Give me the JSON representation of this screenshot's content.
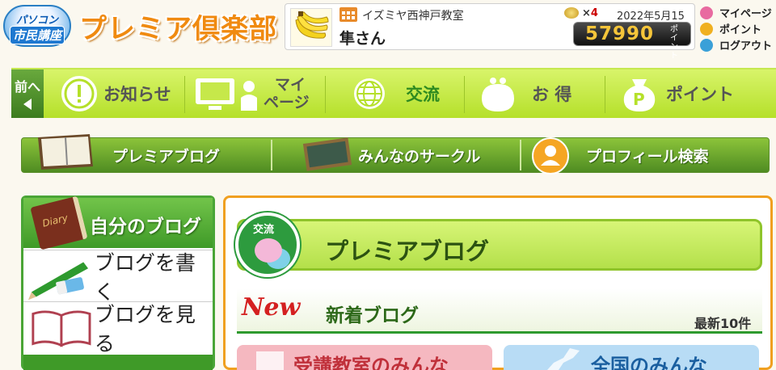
{
  "header": {
    "logo_line1": "パソコン",
    "logo_line2": "市民講座",
    "site_title": "プレミア倶楽部",
    "school_name": "イズミヤ西神戸教室",
    "user_name": "隼さん",
    "coin_label": "×",
    "coin_count": "4",
    "date": "2022年5月15日",
    "points_value": "57990",
    "points_unit": "ポイント",
    "avatar_icon": "banana-icon",
    "links": [
      {
        "label": "マイページ",
        "icon": "person-icon",
        "color": "#e86aa0"
      },
      {
        "label": "ポイント",
        "icon": "coin-icon",
        "color": "#f0b020"
      },
      {
        "label": "ログアウト",
        "icon": "key-icon",
        "color": "#3aa0d8"
      }
    ]
  },
  "nav": {
    "prev_label": "前へ",
    "items": [
      {
        "label": "お知らせ",
        "icon": "exclamation-icon"
      },
      {
        "label": "マイページ",
        "line1": "マイ",
        "line2": "ページ",
        "icon": "monitor-person-icon"
      },
      {
        "label": "交流",
        "icon": "globe-icon",
        "active": true
      },
      {
        "label": "お 得",
        "icon": "purse-icon"
      },
      {
        "label": "ポイント",
        "icon": "point-bag-icon"
      }
    ]
  },
  "subnav": {
    "items": [
      {
        "label": "プレミアブログ",
        "icon": "notebook-icon"
      },
      {
        "label": "みんなのサークル",
        "icon": "chalkboard-icon"
      },
      {
        "label": "プロフィール検索",
        "icon": "profile-icon"
      }
    ]
  },
  "sidebar": {
    "title": "自分のブログ",
    "diary_text": "Diary",
    "items": [
      {
        "label": "ブログを書く",
        "icon": "pencil-eraser-icon"
      },
      {
        "label": "ブログを見る",
        "icon": "open-book-icon"
      }
    ]
  },
  "main": {
    "badge_label": "交流",
    "banner_title": "プレミアブログ",
    "new_badge": "New",
    "new_title": "新着ブログ",
    "new_count": "最新10件",
    "tabs": [
      {
        "label": "受講教室のみんな",
        "icon": "school-building-icon",
        "bg": "#f5b8c0",
        "color": "#c0303a"
      },
      {
        "label": "全国のみんな",
        "icon": "japan-map-icon",
        "bg": "#b8dcf5",
        "color": "#1a5fa0"
      }
    ]
  }
}
